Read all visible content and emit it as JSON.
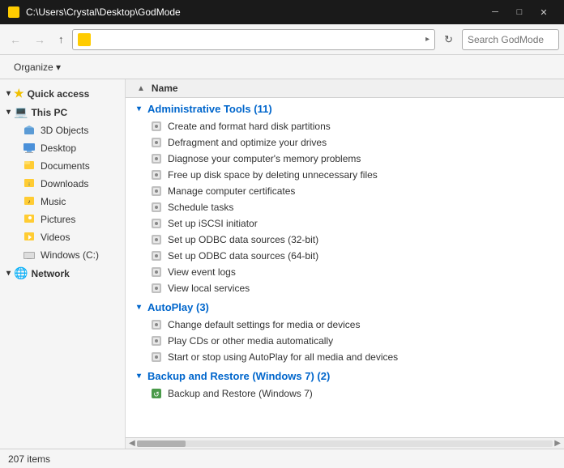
{
  "titleBar": {
    "path": "C:\\Users\\Crystal\\Desktop\\GodMode",
    "icon": "folder-icon"
  },
  "toolbar": {
    "backBtn": "←",
    "forwardBtn": "→",
    "upBtn": "↑",
    "addressBarText": "",
    "addressBarIcon": "folder-icon",
    "refreshBtn": "↻",
    "searchPlaceholder": "Search GodMode"
  },
  "organizeBar": {
    "organizeLabel": "Organize ▾"
  },
  "sidebar": {
    "quickAccess": "Quick access",
    "thisPC": "This PC",
    "items3DObjects": "3D Objects",
    "itemsDesktop": "Desktop",
    "itemsDocuments": "Documents",
    "itemsDownloads": "Downloads",
    "itemsMusic": "Music",
    "itemsPictures": "Pictures",
    "itemsVideos": "Videos",
    "itemsWindowsC": "Windows (C:)",
    "network": "Network"
  },
  "columnHeader": {
    "nameLabel": "Name",
    "collapseIcon": "▲"
  },
  "sections": [
    {
      "title": "Administrative Tools (11)",
      "items": [
        "Create and format hard disk partitions",
        "Defragment and optimize your drives",
        "Diagnose your computer's memory problems",
        "Free up disk space by deleting unnecessary files",
        "Manage computer certificates",
        "Schedule tasks",
        "Set up iSCSI initiator",
        "Set up ODBC data sources (32-bit)",
        "Set up ODBC data sources (64-bit)",
        "View event logs",
        "View local services"
      ]
    },
    {
      "title": "AutoPlay (3)",
      "items": [
        "Change default settings for media or devices",
        "Play CDs or other media automatically",
        "Start or stop using AutoPlay for all media and devices"
      ]
    },
    {
      "title": "Backup and Restore (Windows 7) (2)",
      "items": [
        "Backup and Restore (Windows 7)"
      ]
    }
  ],
  "statusBar": {
    "itemCount": "207 items"
  },
  "colors": {
    "accent": "#0066cc",
    "titleBg": "#1a1a1a",
    "sidebarBg": "#f5f5f5",
    "activeBg": "#cce8ff",
    "hoverBg": "#e5f3ff"
  }
}
